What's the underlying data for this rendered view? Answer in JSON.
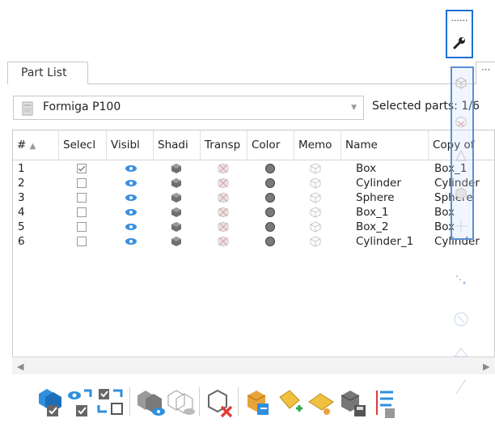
{
  "toolbar_top": {
    "overflow_label": "......",
    "tool_icon": "wrench-icon"
  },
  "tabs": [
    {
      "label": "Part List"
    }
  ],
  "tab_overflow_label": "···",
  "printer": {
    "selected": "Formiga P100"
  },
  "selected_parts": {
    "label": "Selected parts:",
    "value": "1/6"
  },
  "table": {
    "columns": [
      "#",
      "Selecl",
      "Visibl",
      "Shadi",
      "Transp",
      "Color",
      "Memo",
      "Name",
      "Copy of"
    ],
    "rows": [
      {
        "num": "1",
        "selected": true,
        "name": "Box",
        "copy_of": "Box_1"
      },
      {
        "num": "2",
        "selected": false,
        "name": "Cylinder",
        "copy_of": "Cylinder"
      },
      {
        "num": "3",
        "selected": false,
        "name": "Sphere",
        "copy_of": "Sphere"
      },
      {
        "num": "4",
        "selected": false,
        "name": "Box_1",
        "copy_of": "Box"
      },
      {
        "num": "5",
        "selected": false,
        "name": "Box_2",
        "copy_of": "Box"
      },
      {
        "num": "6",
        "selected": false,
        "name": "Cylinder_1",
        "copy_of": "Cylinder"
      }
    ]
  },
  "colors": {
    "accent": "#1f6fd1",
    "eye": "#3a8fe0",
    "selection": "#5b8fd6",
    "ghost": "#c9c9c9"
  },
  "side_toolbar_icons": [
    "part-ghost-icon",
    "part-ghost-icon",
    "part-ghost-icon",
    "part-ghost-icon",
    "part-ghost-icon",
    "dots-icon",
    "circle-arrow-icon",
    "triangle-icon",
    "line-icon"
  ],
  "bottom_toolbar_icons": [
    "select-all-icon",
    "select-visible-icon",
    "invert-selection-icon",
    "show-parts-icon",
    "hide-parts-icon",
    "delete-part-icon",
    "color-part-icon",
    "add-part-icon",
    "move-part-icon",
    "save-part-icon",
    "list-settings-icon"
  ]
}
